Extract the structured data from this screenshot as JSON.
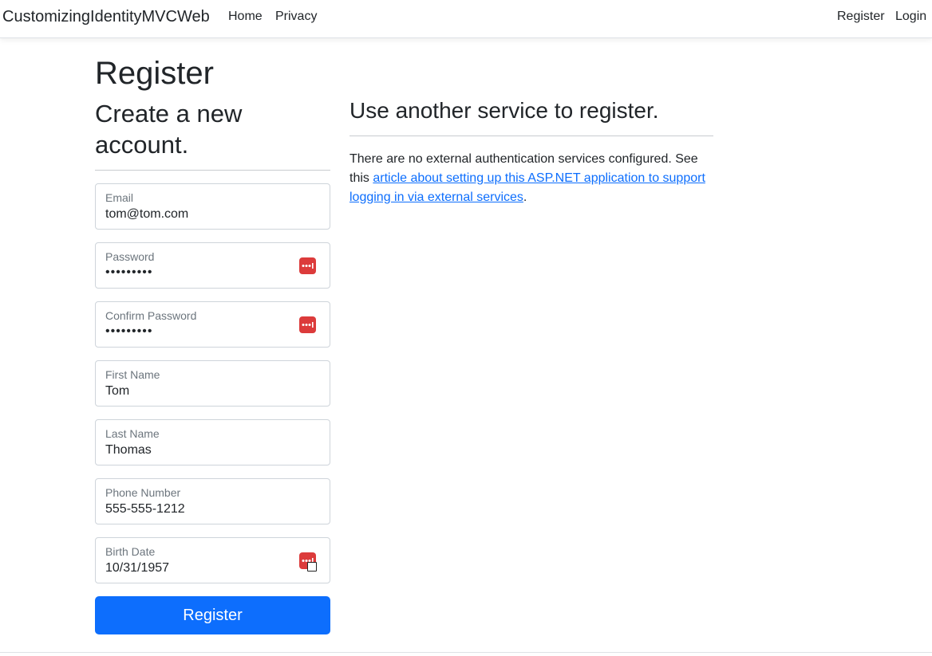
{
  "navbar": {
    "brand": "CustomizingIdentityMVCWeb",
    "links": [
      {
        "label": "Home"
      },
      {
        "label": "Privacy"
      }
    ],
    "right_links": [
      {
        "label": "Register"
      },
      {
        "label": "Login"
      }
    ]
  },
  "page": {
    "title": "Register",
    "form_heading": "Create a new account.",
    "external_heading": "Use another service to register."
  },
  "form": {
    "fields": [
      {
        "label": "Email",
        "value": "tom@tom.com"
      },
      {
        "label": "Password",
        "value": "•••••••••"
      },
      {
        "label": "Confirm Password",
        "value": "•••••••••"
      },
      {
        "label": "First Name",
        "value": "Tom"
      },
      {
        "label": "Last Name",
        "value": "Thomas"
      },
      {
        "label": "Phone Number",
        "value": "555-555-1212"
      },
      {
        "label": "Birth Date",
        "value": "10/31/1957"
      }
    ],
    "submit_label": "Register"
  },
  "external": {
    "text_before": "There are no external authentication services configured. See this ",
    "link_text": "article about setting up this ASP.NET application to support logging in via external services",
    "text_after": "."
  },
  "icons": {
    "password_manager": "password-manager-icon",
    "calendar": "calendar-icon"
  },
  "colors": {
    "primary": "#0d6efd",
    "password_manager_icon": "#dc3b3b"
  }
}
